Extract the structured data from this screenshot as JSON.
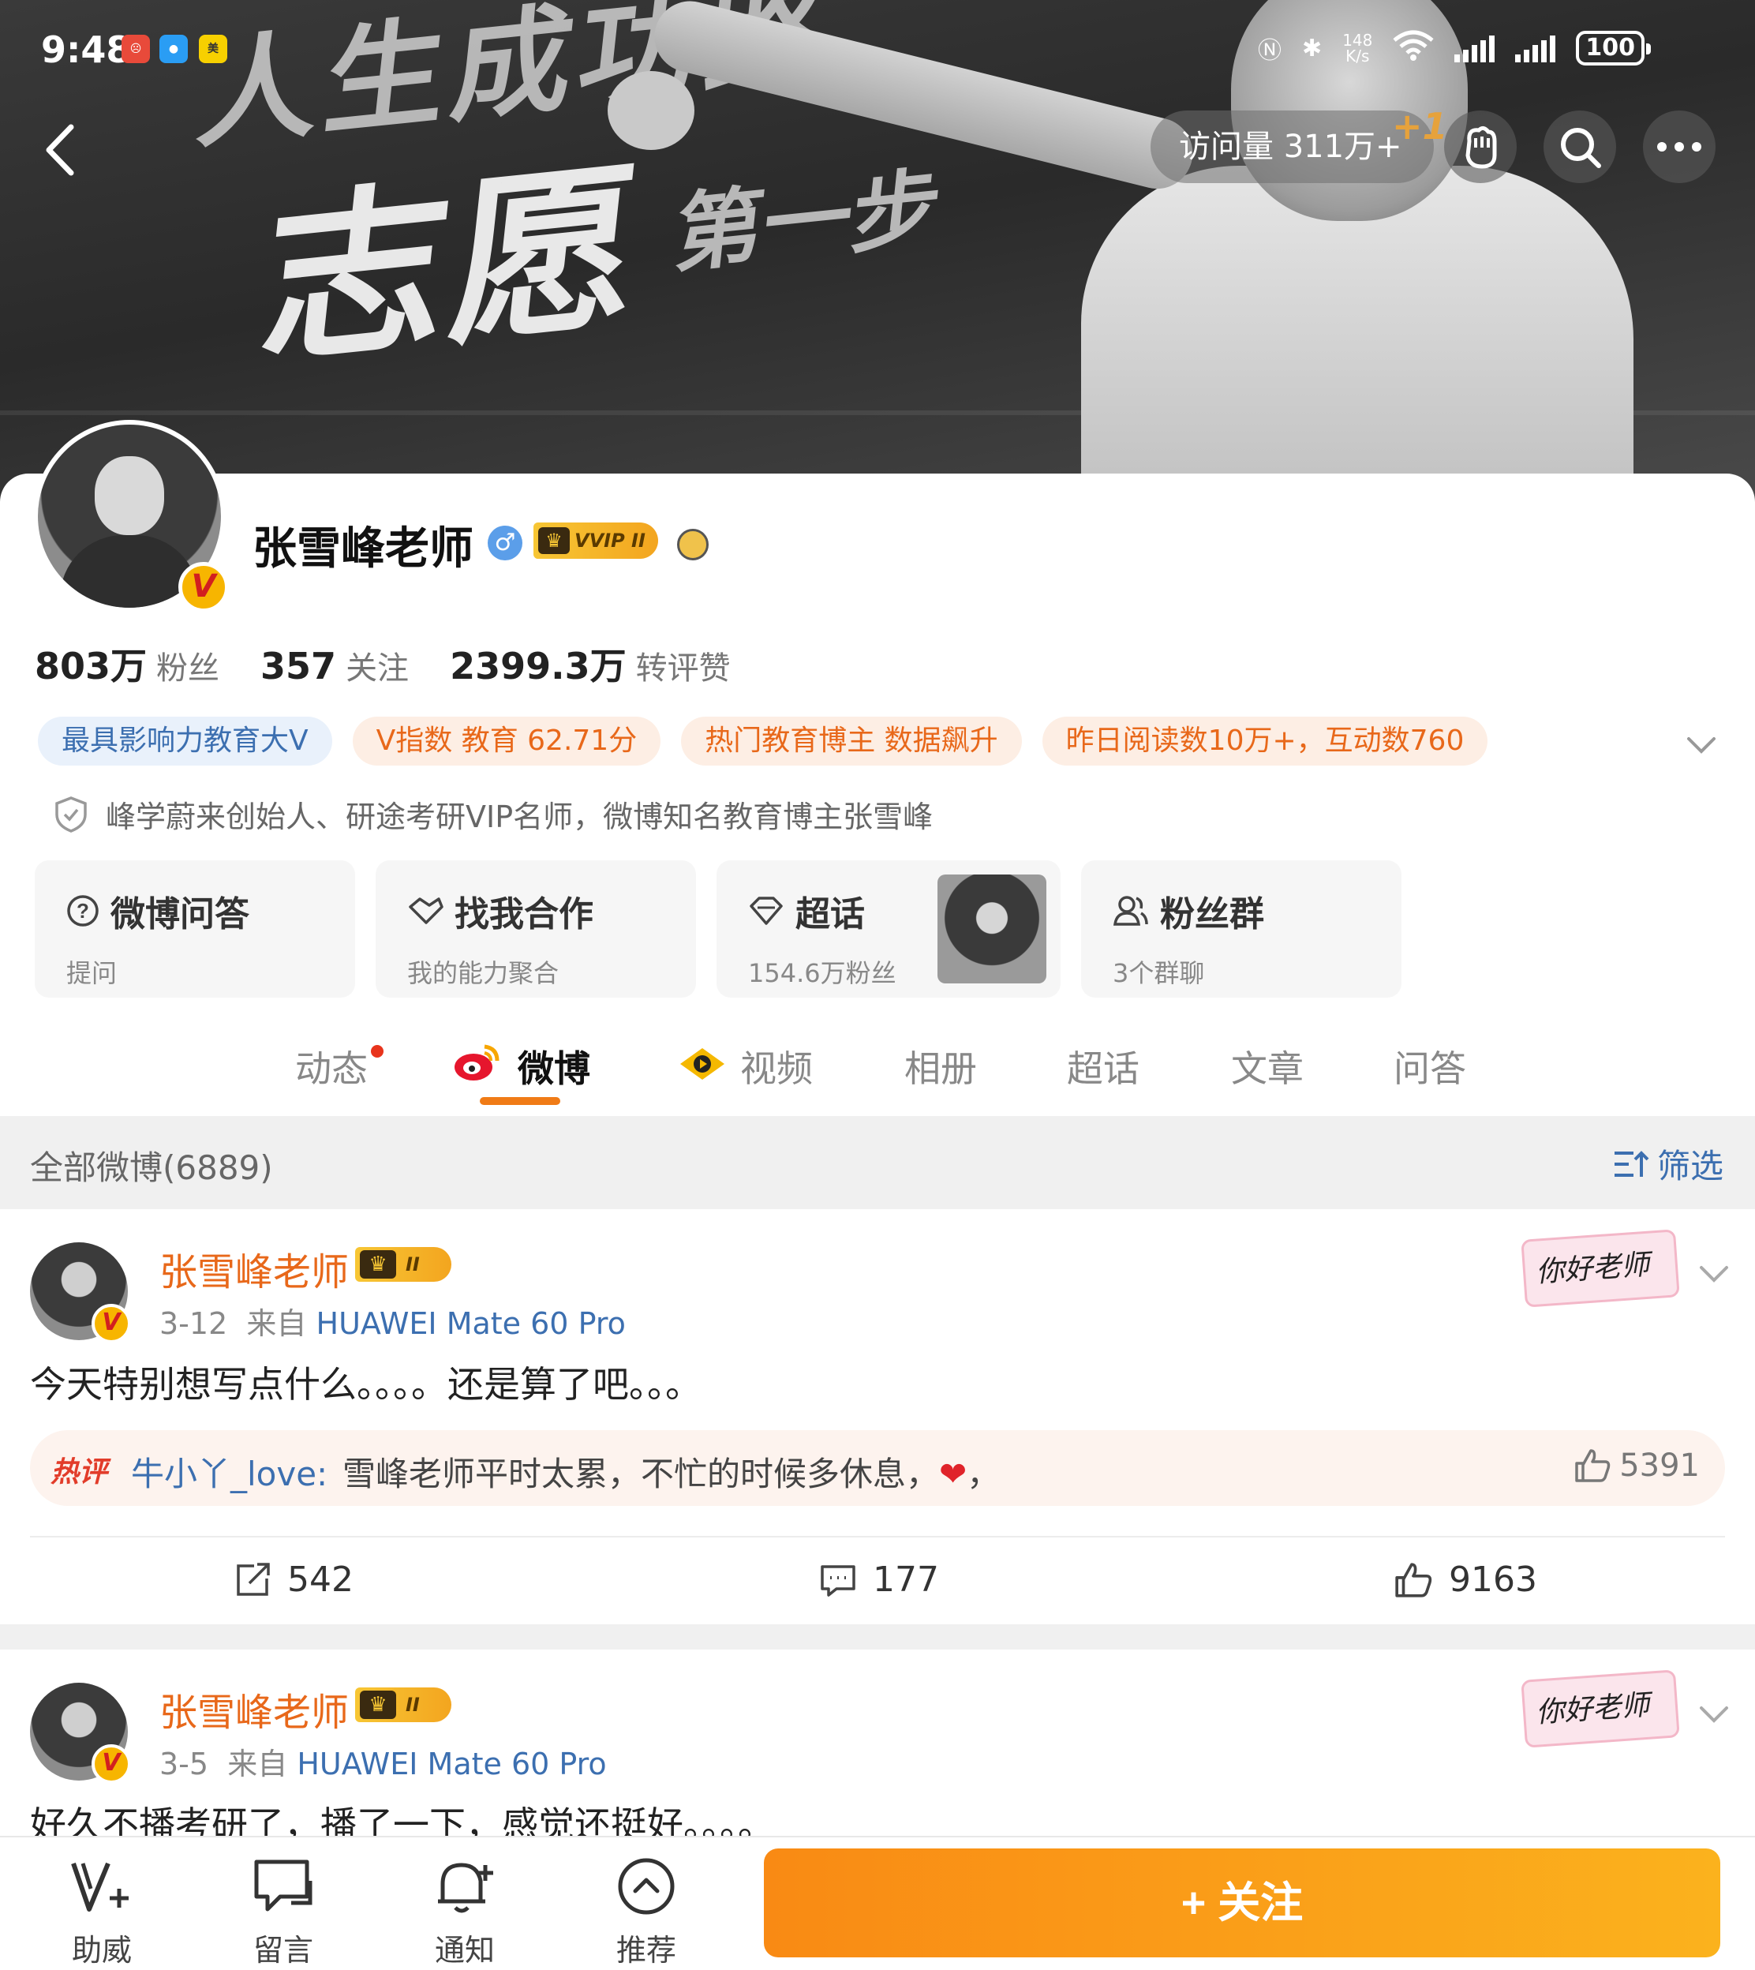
{
  "status_bar": {
    "time": "9:48",
    "network_speed": "148",
    "network_speed_unit": "K/s",
    "battery": "100"
  },
  "header": {
    "visits": "访问量 311万+",
    "visits_plus": "+1",
    "banner_text_top": "人生成功路",
    "banner_text_main": "志愿",
    "banner_text_small": "第一步"
  },
  "profile": {
    "name": "张雪峰老师",
    "gender_symbol": "♂",
    "vip_label": "VVIP II",
    "followers_num": "803万",
    "followers_label": "粉丝",
    "following_num": "357",
    "following_label": "关注",
    "likes_num": "2399.3万",
    "likes_label": "转评赞",
    "tags": [
      "最具影响力教育大V",
      "V指数 教育 62.71分",
      "热门教育博主 数据飙升",
      "昨日阅读数10万+，互动数760"
    ],
    "bio": "峰学蔚来创始人、研途考研VIP名师，微博知名教育博主张雪峰"
  },
  "entries": [
    {
      "title": "微博问答",
      "sub": "提问"
    },
    {
      "title": "找我合作",
      "sub": "我的能力聚合"
    },
    {
      "title": "超话",
      "sub": "154.6万粉丝"
    },
    {
      "title": "粉丝群",
      "sub": "3个群聊"
    }
  ],
  "tabs": [
    "动态",
    "微博",
    "视频",
    "相册",
    "超话",
    "文章",
    "问答"
  ],
  "feed": {
    "count_label": "全部微博(6889)",
    "filter_label": "筛选"
  },
  "posts": [
    {
      "author": "张雪峰老师",
      "date": "3-12",
      "source_prefix": "来自",
      "device": "HUAWEI Mate 60 Pro",
      "sticker": "你好老师",
      "text": "今天特别想写点什么。。。。还是算了吧。。。",
      "hot_label": "热评",
      "hot_user": "牛小丫_love:",
      "hot_text": "雪峰老师平时太累，不忙的时候多休息，",
      "hot_text_end": "，",
      "hot_likes": "5391",
      "reposts": "542",
      "comments": "177",
      "likes": "9163"
    },
    {
      "author": "张雪峰老师",
      "date": "3-5",
      "source_prefix": "来自",
      "device": "HUAWEI Mate 60 Pro",
      "sticker": "你好老师",
      "text": "好久不播考研了，播了一下，感觉还挺好。。。。"
    }
  ],
  "bottom_bar": {
    "items": [
      "助威",
      "留言",
      "通知",
      "推荐"
    ],
    "follow": "+ 关注"
  },
  "colors": {
    "accent_orange": "#F07B16",
    "link_blue": "#3C6FB0",
    "vip_gold": "#F7C634"
  }
}
